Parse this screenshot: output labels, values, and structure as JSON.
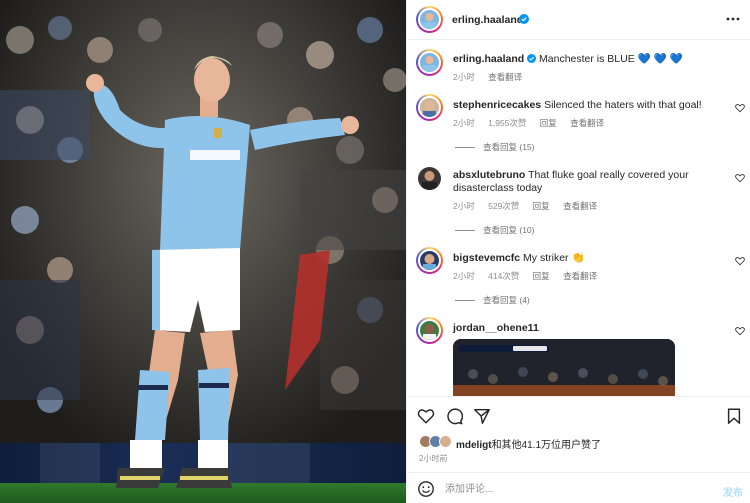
{
  "post": {
    "author": "erling.haaland",
    "more_icon": "more-horizontal-icon",
    "verified_icon": "verified-badge-icon",
    "accent_color": "#0095f6",
    "caption": {
      "username": "erling.haaland",
      "text": "Manchester is BLUE 💙 💙 💙",
      "time": "2小时",
      "translate": "查看翻译"
    }
  },
  "comments": [
    {
      "username": "stephenricecakes",
      "text": "Silenced the haters with that goal!",
      "time": "2小时",
      "likes": "1,955次赞",
      "reply": "回复",
      "translate": "查看翻译",
      "view_replies": "查看回复 (15)"
    },
    {
      "username": "absxlutebruno",
      "text": "That fluke goal really covered your disasterclass today",
      "time": "2小时",
      "likes": "529次赞",
      "reply": "回复",
      "translate": "查看翻译",
      "view_replies": "查看回复 (10)"
    },
    {
      "username": "bigstevemcfc",
      "text": "My striker 👏",
      "time": "2小时",
      "likes": "414次赞",
      "reply": "回复",
      "translate": "查看翻译",
      "view_replies": "查看回复 (4)"
    },
    {
      "username": "jordan__ohene11",
      "text": ""
    }
  ],
  "actions": {
    "icons": [
      "heart-icon",
      "comment-icon",
      "share-icon",
      "bookmark-icon"
    ],
    "liked_by_user": "mdeligt",
    "liked_by_rest": "和其他41.1万位用户赞了",
    "time_ago": "2小时前",
    "comment_placeholder": "添加评论...",
    "post_button": "发布"
  }
}
